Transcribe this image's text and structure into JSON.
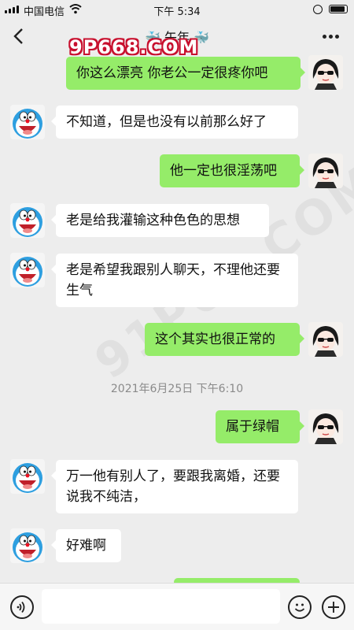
{
  "status_bar": {
    "carrier": "中国电信",
    "time": "下午 5:34",
    "battery_level": 0.9
  },
  "header": {
    "title": "午年",
    "watermark": "9P668.COM",
    "diagonal_watermark": "91P08.COM"
  },
  "messages": [
    {
      "side": "right",
      "text": "你这么漂亮 你老公一定很疼你吧"
    },
    {
      "side": "left",
      "text": "不知道，但是也没有以前那么好了"
    },
    {
      "side": "right",
      "text": "他一定也很淫荡吧"
    },
    {
      "side": "left",
      "text": "老是给我灌输这种色色的思想"
    },
    {
      "side": "left",
      "text": "老是希望我跟别人聊天，不理他还要生气"
    },
    {
      "side": "right",
      "text": "这个其实也很正常的"
    },
    {
      "side": "right",
      "text": "属于绿帽"
    },
    {
      "side": "left",
      "text": "万一他有别人了，要跟我离婚，还要说我不纯洁，"
    },
    {
      "side": "left",
      "text": "好难啊"
    }
  ],
  "timestamp": "2021年6月25日 下午6:10",
  "input_bar": {
    "placeholder": ""
  },
  "avatars": {
    "self": "sunglasses-girl-avatar",
    "friend": "doraemon-avatar"
  },
  "colors": {
    "background": "#ededed",
    "right_bubble": "#95ec69",
    "left_bubble": "#ffffff",
    "watermark": "#c8102e"
  }
}
